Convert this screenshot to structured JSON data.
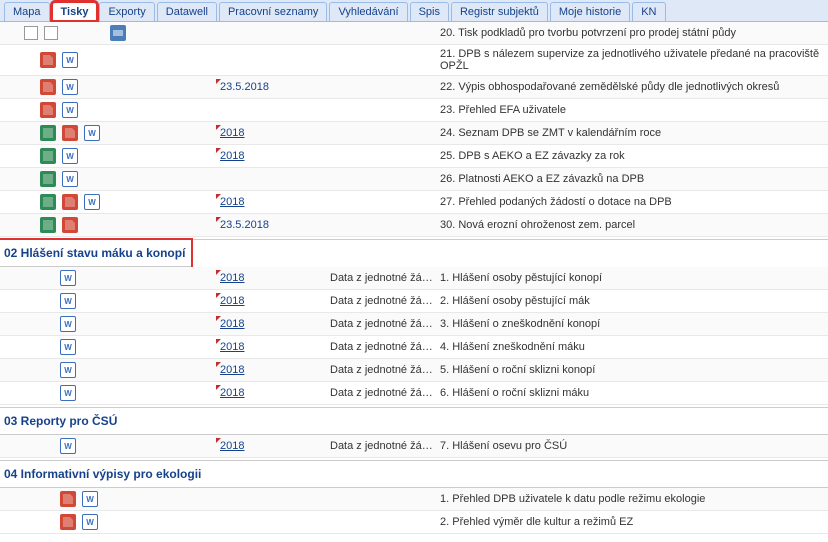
{
  "tabs": [
    {
      "label": "Mapa"
    },
    {
      "label": "Tisky"
    },
    {
      "label": "Exporty"
    },
    {
      "label": "Datawell"
    },
    {
      "label": "Pracovní seznamy"
    },
    {
      "label": "Vyhledávání"
    },
    {
      "label": "Spis"
    },
    {
      "label": "Registr subjektů"
    },
    {
      "label": "Moje historie"
    },
    {
      "label": "KN"
    }
  ],
  "sections": {
    "top_rows": [
      {
        "icons": [
          "folder",
          "folder",
          "print"
        ],
        "date": "",
        "src": "",
        "desc": "20. Tisk podkladů pro tvorbu potvrzení pro prodej státní půdy"
      },
      {
        "icons": [
          "pdf",
          "word"
        ],
        "date": "",
        "src": "",
        "desc": "21. DPB s nálezem supervize za jednotlivého uživatele předané na pracoviště OPŽL"
      },
      {
        "icons": [
          "pdf",
          "word"
        ],
        "date": "23.5.2018",
        "plain": true,
        "src": "",
        "desc": "22. Výpis obhospodařované zemědělské půdy dle jednotlivých okresů"
      },
      {
        "icons": [
          "pdf",
          "word"
        ],
        "date": "",
        "src": "",
        "desc": "23. Přehled EFA uživatele"
      },
      {
        "icons": [
          "xls",
          "pdf",
          "word"
        ],
        "date": "2018",
        "src": "",
        "desc": "24. Seznam DPB se ZMT v kalendářním roce"
      },
      {
        "icons": [
          "xls",
          "word"
        ],
        "date": "2018",
        "src": "",
        "desc": "25. DPB s AEKO a EZ závazky za rok"
      },
      {
        "icons": [
          "xls",
          "word"
        ],
        "date": "",
        "src": "",
        "desc": "26. Platnosti AEKO a EZ závazků na DPB"
      },
      {
        "icons": [
          "xls",
          "pdf",
          "word"
        ],
        "date": "2018",
        "src": "",
        "desc": "27. Přehled podaných žádostí o dotace na DPB"
      },
      {
        "icons": [
          "xls",
          "pdf"
        ],
        "date": "23.5.2018",
        "plain": true,
        "src": "",
        "desc": "30. Nová erozní ohroženost zem. parcel"
      }
    ],
    "s02": {
      "title": "02 Hlášení stavu máku a konopí",
      "rows": [
        {
          "icons": [
            "word"
          ],
          "date": "2018",
          "src": "Data z jednotné žá…",
          "desc": "1. Hlášení osoby pěstující konopí"
        },
        {
          "icons": [
            "word"
          ],
          "date": "2018",
          "src": "Data z jednotné žá…",
          "desc": "2. Hlášení osoby pěstující mák"
        },
        {
          "icons": [
            "word"
          ],
          "date": "2018",
          "src": "Data z jednotné žá…",
          "desc": "3. Hlášení o zneškodnění konopí"
        },
        {
          "icons": [
            "word"
          ],
          "date": "2018",
          "src": "Data z jednotné žá…",
          "desc": "4. Hlášení zneškodnění máku"
        },
        {
          "icons": [
            "word"
          ],
          "date": "2018",
          "src": "Data z jednotné žá…",
          "desc": "5. Hlášení o roční sklizni konopí"
        },
        {
          "icons": [
            "word"
          ],
          "date": "2018",
          "src": "Data z jednotné žá…",
          "desc": "6. Hlášení o roční sklizni máku"
        }
      ]
    },
    "s03": {
      "title": "03 Reporty pro ČSÚ",
      "rows": [
        {
          "icons": [
            "word"
          ],
          "date": "2018",
          "src": "Data z jednotné žá…",
          "desc": "7. Hlášení osevu pro ČSÚ"
        }
      ]
    },
    "s04": {
      "title": "04 Informativní výpisy pro ekologii",
      "rows": [
        {
          "icons": [
            "pdf",
            "word"
          ],
          "date": "",
          "src": "",
          "desc": "1. Přehled DPB uživatele k datu podle režimu ekologie"
        },
        {
          "icons": [
            "pdf",
            "word"
          ],
          "date": "",
          "src": "",
          "desc": "2. Přehled výměr dle kultur a režimů EZ"
        }
      ]
    }
  }
}
